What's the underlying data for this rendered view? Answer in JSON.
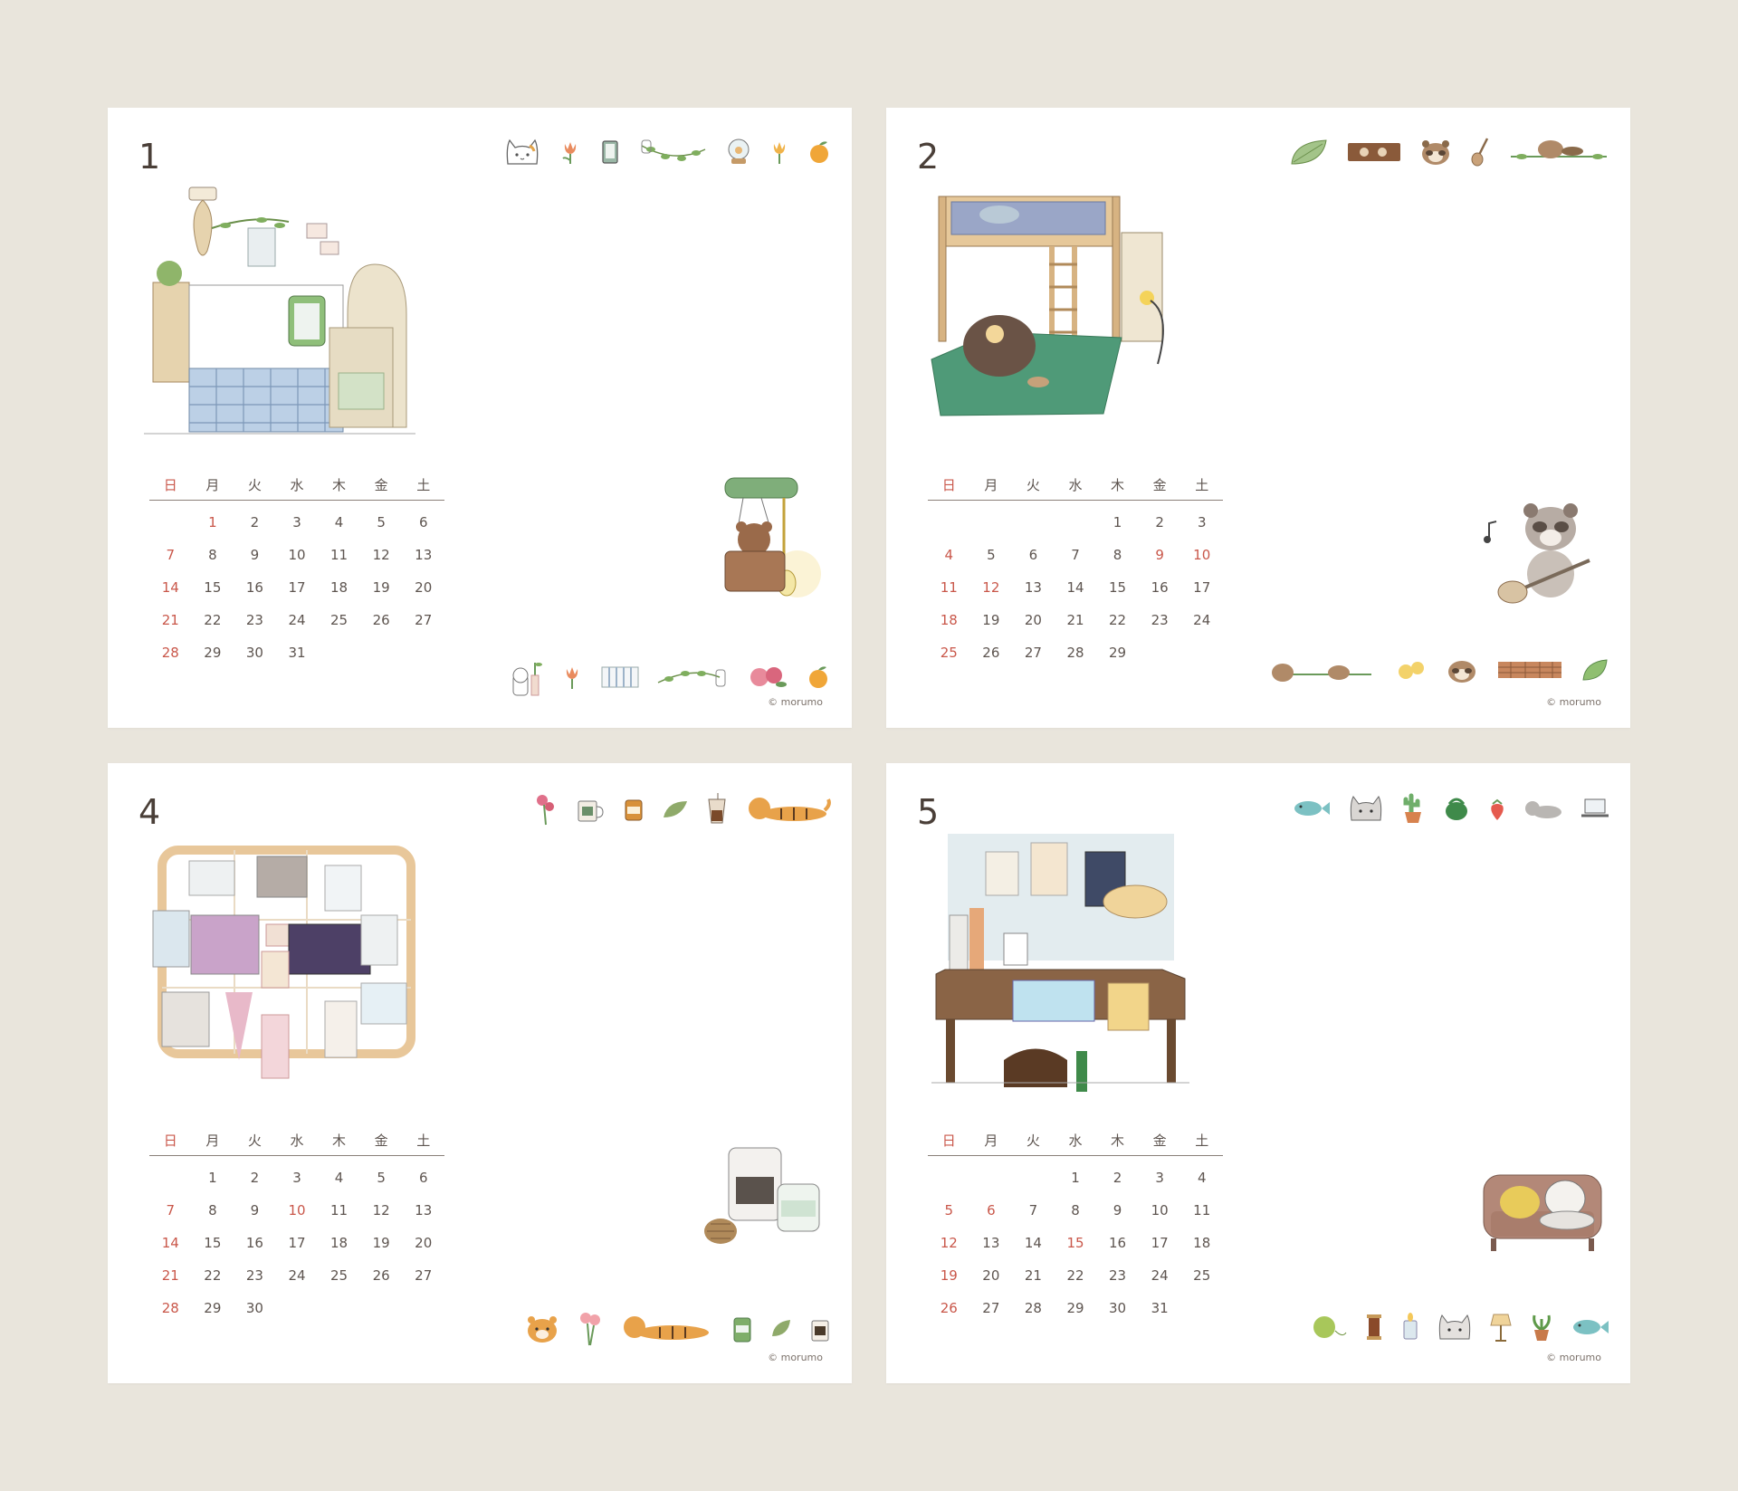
{
  "weekdays": [
    "日",
    "月",
    "火",
    "水",
    "木",
    "金",
    "土"
  ],
  "credit": "© morumo",
  "colors": {
    "background": "#e9e5dc",
    "holiday_red": "#c9574a",
    "text": "#5e5550"
  },
  "pages": [
    {
      "month": "1",
      "illustration": "kotatsu-living-room",
      "side_illustration": "hanging-bear-bag",
      "weeks": [
        [
          "",
          "1",
          "2",
          "3",
          "4",
          "5",
          "6"
        ],
        [
          "7",
          "8",
          "9",
          "10",
          "11",
          "12",
          "13"
        ],
        [
          "14",
          "15",
          "16",
          "17",
          "18",
          "19",
          "20"
        ],
        [
          "21",
          "22",
          "23",
          "24",
          "25",
          "26",
          "27"
        ],
        [
          "28",
          "29",
          "30",
          "31",
          "",
          "",
          ""
        ]
      ],
      "red_dates": [
        "1",
        "7",
        "14",
        "21",
        "28"
      ],
      "top_icons": [
        "cat-face-icon",
        "tulip-icon",
        "tablet-icon",
        "vine-icon",
        "snow-globe-icon",
        "tulip-icon",
        "orange-icon"
      ],
      "bottom_icons": [
        "cat-vase-icon",
        "tulip-icon",
        "striped-fabric-icon",
        "vine-icon",
        "camellia-icon",
        "orange-icon"
      ]
    },
    {
      "month": "2",
      "illustration": "loft-bed-room",
      "side_illustration": "tanuki-guitar",
      "weeks": [
        [
          "",
          "",
          "",
          "",
          "1",
          "2",
          "3"
        ],
        [
          "4",
          "5",
          "6",
          "7",
          "8",
          "9",
          "10"
        ],
        [
          "11",
          "12",
          "13",
          "14",
          "15",
          "16",
          "17"
        ],
        [
          "18",
          "19",
          "20",
          "21",
          "22",
          "23",
          "24"
        ],
        [
          "25",
          "26",
          "27",
          "28",
          "29",
          "",
          ""
        ]
      ],
      "red_dates": [
        "4",
        "9",
        "10",
        "11",
        "12",
        "18",
        "25"
      ],
      "top_icons": [
        "leaf-icon",
        "tanuki-sign-icon",
        "tanuki-face-icon",
        "guitar-icon",
        "tanuki-vine-icon"
      ],
      "bottom_icons": [
        "tanuki-branch-icon",
        "tanuki-sleeping-icon",
        "chicks-icon",
        "tanuki-face-icon",
        "plaid-fabric-icon",
        "leaf-icon"
      ]
    },
    {
      "month": "4",
      "illustration": "photo-wire-grid",
      "side_illustration": "candles-pinecone",
      "weeks": [
        [
          "",
          "1",
          "2",
          "3",
          "4",
          "5",
          "6"
        ],
        [
          "7",
          "8",
          "9",
          "10",
          "11",
          "12",
          "13"
        ],
        [
          "14",
          "15",
          "16",
          "17",
          "18",
          "19",
          "20"
        ],
        [
          "21",
          "22",
          "23",
          "24",
          "25",
          "26",
          "27"
        ],
        [
          "28",
          "29",
          "30",
          "",
          "",
          "",
          ""
        ]
      ],
      "red_dates": [
        "7",
        "10",
        "14",
        "21",
        "28"
      ],
      "top_icons": [
        "rose-icon",
        "mug-icon",
        "jar-icon",
        "leaf-icon",
        "iced-coffee-icon",
        "tiger-icon"
      ],
      "bottom_icons": [
        "tiger-face-icon",
        "roses-icon",
        "tiger-icon",
        "candle-jar-icon",
        "leaf-icon",
        "coffee-cup-icon"
      ]
    },
    {
      "month": "5",
      "illustration": "wooden-desk",
      "side_illustration": "cat-on-sofa",
      "weeks": [
        [
          "",
          "",
          "",
          "1",
          "2",
          "3",
          "4"
        ],
        [
          "5",
          "6",
          "7",
          "8",
          "9",
          "10",
          "11"
        ],
        [
          "12",
          "13",
          "14",
          "15",
          "16",
          "17",
          "18"
        ],
        [
          "19",
          "20",
          "21",
          "22",
          "23",
          "24",
          "25"
        ],
        [
          "26",
          "27",
          "28",
          "29",
          "30",
          "31",
          ""
        ]
      ],
      "red_dates": [
        "5",
        "6",
        "12",
        "15",
        "19",
        "26"
      ],
      "top_icons": [
        "fish-icon",
        "cat-face-icon",
        "cactus-icon",
        "watering-can-icon",
        "strawberry-icon",
        "cat-lying-icon",
        "laptop-icon"
      ],
      "bottom_icons": [
        "yarn-ball-icon",
        "thread-spool-icon",
        "candle-icon",
        "cat-face-icon",
        "lamp-icon",
        "plant-icon",
        "fish-icon"
      ]
    }
  ]
}
